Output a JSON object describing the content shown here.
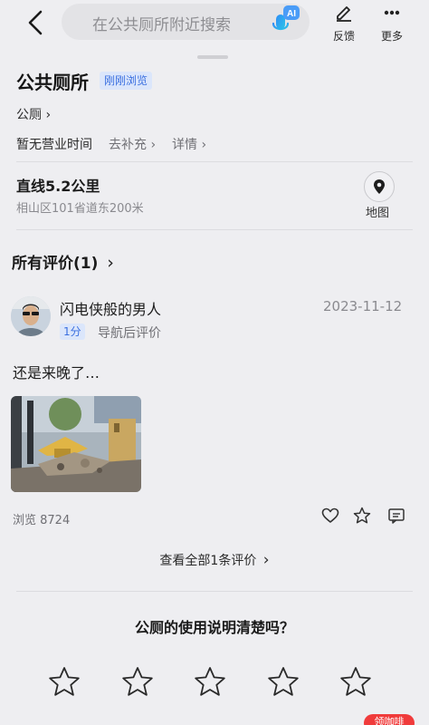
{
  "header": {
    "search_placeholder": "在公共厕所附近搜索",
    "ai_badge": "AI",
    "feedback_label": "反馈",
    "more_label": "更多"
  },
  "place": {
    "title": "公共厕所",
    "status_tag": "刚刚浏览",
    "category": "公厕",
    "hours": "暂无营业时间",
    "hours_supplement": "去补充",
    "hours_details": "详情",
    "distance": "直线5.2公里",
    "address": "相山区101省道东200米",
    "map_label": "地图"
  },
  "reviews": {
    "section_title": "所有评价(1)",
    "items": [
      {
        "user_name": "闪电侠般的男人",
        "date": "2023-11-12",
        "score": "1分",
        "review_type": "导航后评价",
        "text": "还是来晚了…",
        "views": "浏览 8724"
      }
    ],
    "see_all": "查看全部1条评价"
  },
  "rating_prompt": {
    "question": "公厕的使用说明清楚吗？",
    "stars": 5
  },
  "float_badge": "领咖啡",
  "colors": {
    "background": "#eeeef1",
    "accent_blue": "#3a6fe0",
    "tag_bg": "#dbe6fb",
    "badge_red": "#f03b3b"
  }
}
